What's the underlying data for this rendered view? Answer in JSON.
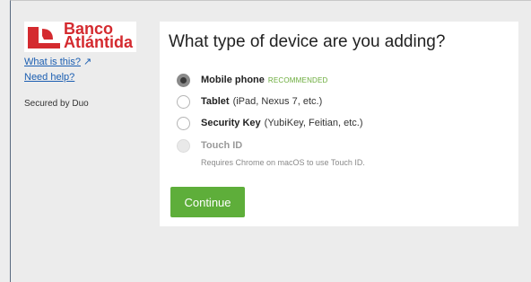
{
  "brand": {
    "line1": "Banco",
    "line2": "Atlántida",
    "color": "#d42a2f"
  },
  "sidebar": {
    "what_is_this": "What is this?",
    "need_help": "Need help?",
    "secured_by": "Secured by Duo"
  },
  "main": {
    "title": "What type of device are you adding?",
    "options": [
      {
        "label": "Mobile phone",
        "badge": "RECOMMENDED",
        "detail": "",
        "selected": true,
        "disabled": false
      },
      {
        "label": "Tablet",
        "detail": "(iPad, Nexus 7, etc.)",
        "selected": false,
        "disabled": false
      },
      {
        "label": "Security Key",
        "detail": "(YubiKey, Feitian, etc.)",
        "selected": false,
        "disabled": false
      },
      {
        "label": "Touch ID",
        "detail": "",
        "selected": false,
        "disabled": true
      }
    ],
    "touchid_note": "Requires Chrome on macOS to use Touch ID.",
    "continue_label": "Continue",
    "accent_color": "#5eae3a"
  }
}
